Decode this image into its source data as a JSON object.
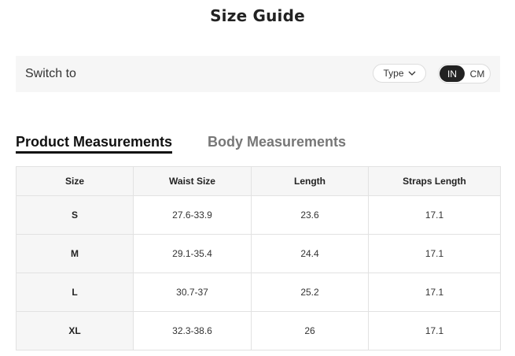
{
  "page": {
    "title": "Size Guide"
  },
  "switch": {
    "label": "Switch to",
    "type_label": "Type",
    "units": [
      "IN",
      "CM"
    ],
    "active_unit": "IN"
  },
  "tabs": [
    {
      "label": "Product Measurements",
      "active": true
    },
    {
      "label": "Body Measurements",
      "active": false
    }
  ],
  "table": {
    "headers": [
      "Size",
      "Waist Size",
      "Length",
      "Straps Length"
    ],
    "rows": [
      [
        "S",
        "27.6-33.9",
        "23.6",
        "17.1"
      ],
      [
        "M",
        "29.1-35.4",
        "24.4",
        "17.1"
      ],
      [
        "L",
        "30.7-37",
        "25.2",
        "17.1"
      ],
      [
        "XL",
        "32.3-38.6",
        "26",
        "17.1"
      ]
    ]
  },
  "icons": {
    "type_dropdown": "chevron-down-icon"
  },
  "colors": {
    "text": "#222222",
    "panel_bg": "#f6f6f6",
    "active_toggle_bg": "#222222",
    "inactive_tab": "#777777",
    "border": "#e2e2e2"
  }
}
